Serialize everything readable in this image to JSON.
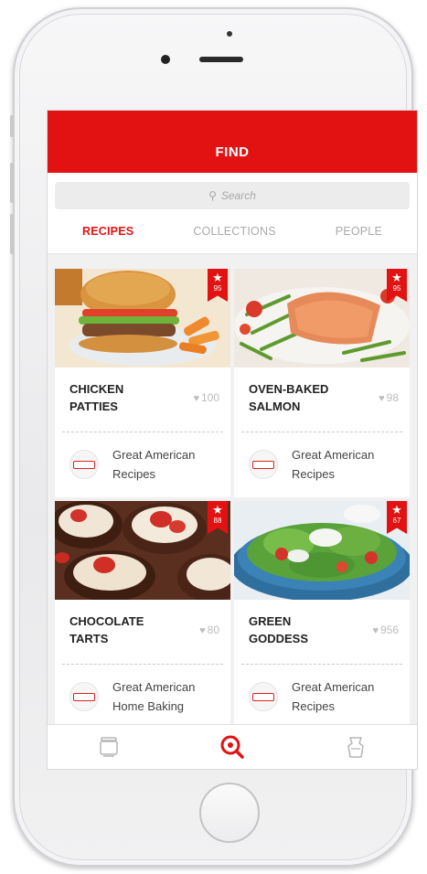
{
  "header": {
    "title": "FIND"
  },
  "search": {
    "placeholder": "Search"
  },
  "tabs": [
    {
      "label": "RECIPES",
      "active": true
    },
    {
      "label": "COLLECTIONS",
      "active": false
    },
    {
      "label": "PEOPLE",
      "active": false
    }
  ],
  "recipes": [
    {
      "title": "CHICKEN\nPATTIES",
      "likes": "100",
      "rating": "95",
      "source": "Great American\nRecipes",
      "image": "burger-photo"
    },
    {
      "title": "OVEN-BAKED\nSALMON",
      "likes": "98",
      "rating": "95",
      "source": "Great American\nRecipes",
      "image": "salmon-photo"
    },
    {
      "title": "CHOCOLATE\nTARTS",
      "likes": "80",
      "rating": "88",
      "source": "Great American\nHome Baking",
      "image": "tarts-photo"
    },
    {
      "title": "GREEN\nGODDESS",
      "likes": "956",
      "rating": "67",
      "source": "Great American\nRecipes",
      "image": "salad-photo"
    }
  ],
  "navbar": {
    "items": [
      {
        "icon": "cooking-pot-icon",
        "active": false
      },
      {
        "icon": "find-search-icon",
        "active": true
      },
      {
        "icon": "chef-apron-icon",
        "active": false
      }
    ]
  },
  "colors": {
    "accent": "#e21212",
    "muted_text": "#aaaaaa",
    "screen_bg": "#f1f1f1"
  }
}
